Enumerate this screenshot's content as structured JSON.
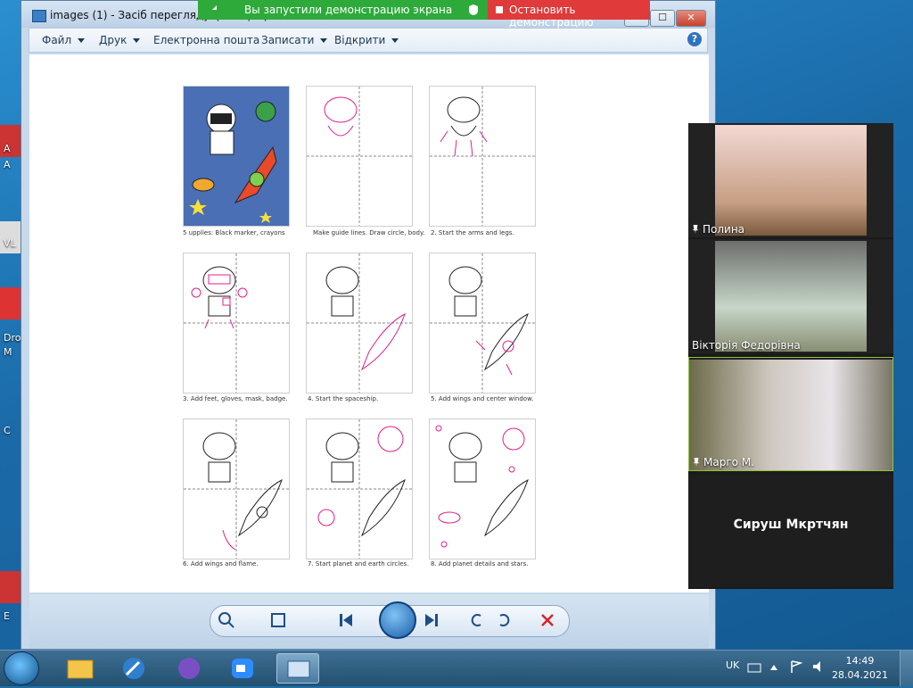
{
  "window": {
    "title": "images (1) - Засіб перегляду фотографій Windows",
    "min": "—",
    "max": "☐",
    "close": "✕",
    "help": "?"
  },
  "menu": [
    {
      "label": "Файл"
    },
    {
      "label": "Друк"
    },
    {
      "label": "Електронна пошта"
    },
    {
      "label": "Записати"
    },
    {
      "label": "Відкрити"
    }
  ],
  "share_banner": {
    "status": "Вы запустили демонстрацию экрана",
    "stop": "Остановить демонстрацию",
    "green": "#2daa3a",
    "red": "#e03a3a"
  },
  "tiles": [
    {
      "caption": "5 upplies: Black marker, crayons"
    },
    {
      "caption": "Make guide lines. Draw circle, body."
    },
    {
      "caption": "2. Start the arms and legs."
    },
    {
      "caption": "3. Add feet, gloves, mask, badge."
    },
    {
      "caption": "4. Start the spaceship."
    },
    {
      "caption": "5. Add wings and center window."
    },
    {
      "caption": "6. Add wings and flame."
    },
    {
      "caption": "7. Start planet and earth circles."
    },
    {
      "caption": "8. Add planet details and stars."
    }
  ],
  "participants": [
    {
      "name": "Полина"
    },
    {
      "name": "Вікторія Федорівна"
    },
    {
      "name": "Марго М."
    },
    {
      "name": "Сируш Мкртчян"
    }
  ],
  "desktop_labels": [
    "A",
    "A",
    "VL",
    "Dro",
    "M",
    "C",
    "E"
  ],
  "taskbar": {
    "lang": "UK",
    "time": "14:49",
    "date": "28.04.2021"
  },
  "colors": {
    "guide": "#e0208a",
    "zoom_active_border": "#8fc43a"
  }
}
